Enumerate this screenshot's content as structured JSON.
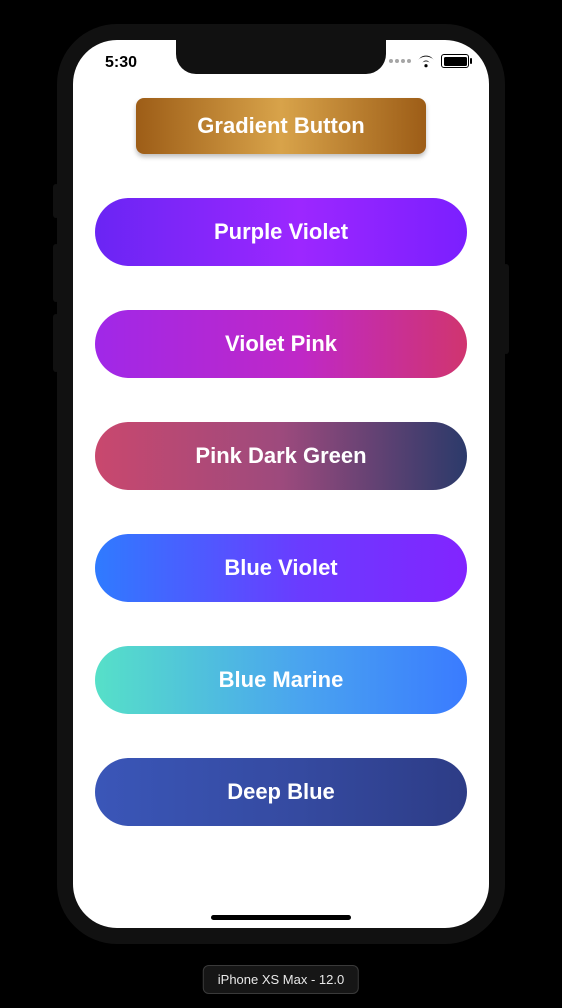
{
  "status_bar": {
    "time": "5:30"
  },
  "header_button": {
    "label": "Gradient Button"
  },
  "buttons": [
    {
      "label": "Purple Violet",
      "gradient": "grad-purple-vio"
    },
    {
      "label": "Violet Pink",
      "gradient": "grad-vio-pink"
    },
    {
      "label": "Pink Dark Green",
      "gradient": "grad-pink-dg"
    },
    {
      "label": "Blue Violet",
      "gradient": "grad-blue-vio"
    },
    {
      "label": "Blue Marine",
      "gradient": "grad-blue-mar"
    },
    {
      "label": "Deep Blue",
      "gradient": "grad-deep-blue"
    }
  ],
  "device_caption": "iPhone XS Max - 12.0"
}
